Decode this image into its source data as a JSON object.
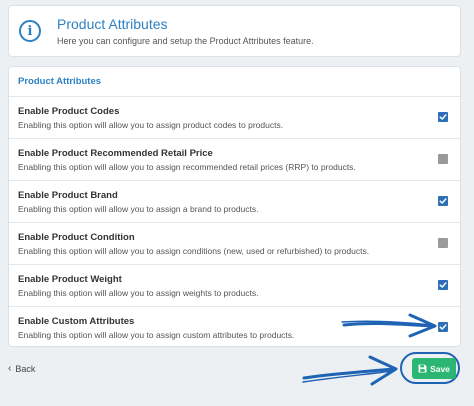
{
  "info": {
    "icon": "info-icon",
    "title": "Product Attributes",
    "description": "Here you can configure and setup the Product Attributes feature."
  },
  "panel": {
    "header": "Product Attributes",
    "options": [
      {
        "title": "Enable Product Codes",
        "description": "Enabling this option will allow you to assign product codes to products.",
        "checked": true
      },
      {
        "title": "Enable Product Recommended Retail Price",
        "description": "Enabling this option will allow you to assign recommended retail prices (RRP) to products.",
        "checked": false
      },
      {
        "title": "Enable Product Brand",
        "description": "Enabling this option will allow you to assign a brand to products.",
        "checked": true
      },
      {
        "title": "Enable Product Condition",
        "description": "Enabling this option will allow you to assign conditions (new, used or refurbished) to products.",
        "checked": false
      },
      {
        "title": "Enable Product Weight",
        "description": "Enabling this option will allow you to assign weights to products.",
        "checked": true
      },
      {
        "title": "Enable Custom Attributes",
        "description": "Enabling this option will allow you to assign custom attributes to products.",
        "checked": true
      }
    ]
  },
  "footer": {
    "back_label": "Back",
    "save_label": "Save"
  },
  "colors": {
    "accent": "#2e82c4",
    "checkbox_on": "#2e6fb5",
    "checkbox_off": "#9a9a9a",
    "save": "#2bb673",
    "annotation": "#1f63b5"
  }
}
